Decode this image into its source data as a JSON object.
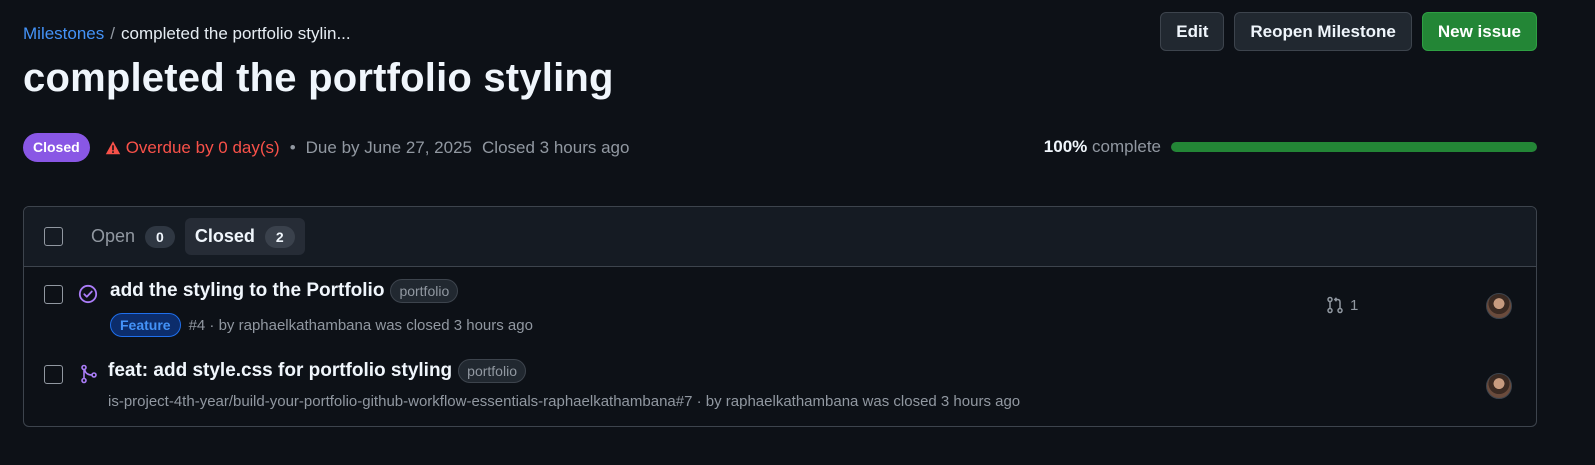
{
  "breadcrumb": {
    "link": "Milestones",
    "separator": "/",
    "current": "completed the portfolio stylin..."
  },
  "title": "completed the portfolio styling",
  "actions": {
    "edit": "Edit",
    "reopen": "Reopen Milestone",
    "new_issue": "New issue"
  },
  "meta": {
    "state": "Closed",
    "overdue": "Overdue by 0 day(s)",
    "dot": "•",
    "due": "Due by June 27, 2025",
    "closed_ago": "Closed 3 hours ago"
  },
  "progress": {
    "percent_label": "100%",
    "complete_label": "complete",
    "fraction": 1.0
  },
  "tabs": {
    "open_label": "Open",
    "open_count": "0",
    "closed_label": "Closed",
    "closed_count": "2"
  },
  "items": [
    {
      "title": "add the styling to the Portfolio",
      "label": "portfolio",
      "type_label": "Feature",
      "subtitle": "#4 · by raphaelkathambana was closed 3 hours ago",
      "linked_prs": "1",
      "icon": "issue-closed-icon"
    },
    {
      "title": "feat: add style.css for portfolio styling",
      "label": "portfolio",
      "subtitle": "is-project-4th-year/build-your-portfolio-github-workflow-essentials-raphaelkathambana#7 · by raphaelkathambana was closed 3 hours ago",
      "icon": "git-merge-icon"
    }
  ],
  "colors": {
    "background": "#0d1117",
    "link": "#4493f8",
    "closed_purple": "#8957e5",
    "danger": "#f85149",
    "success": "#238636"
  }
}
